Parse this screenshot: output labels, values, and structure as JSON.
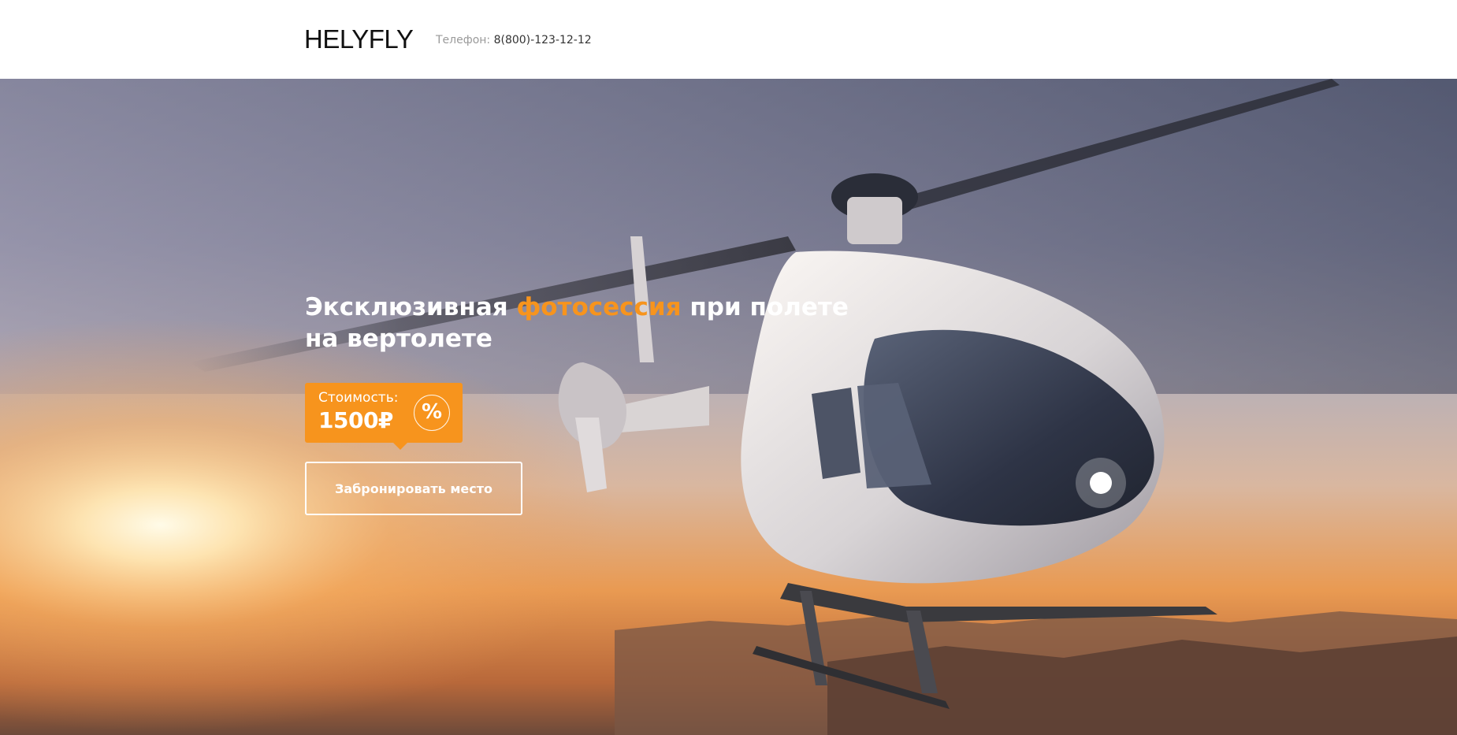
{
  "header": {
    "logo": "HELYFLY",
    "phone_label": "Телефон: ",
    "phone_number": "8(800)-123-12-12"
  },
  "hero": {
    "headline_part1": "Эксклюзивная ",
    "headline_accent": "фотосессия",
    "headline_part2": " при полете на вертолете",
    "price_label": "Стоимость:",
    "price_value": "1500₽",
    "discount_symbol": "%",
    "book_button_label": "Забронировать место"
  },
  "colors": {
    "accent": "#f7941d",
    "text_dark": "#111111",
    "text_muted": "#9a9a9a"
  },
  "icons": {
    "discount": "percent-icon"
  }
}
